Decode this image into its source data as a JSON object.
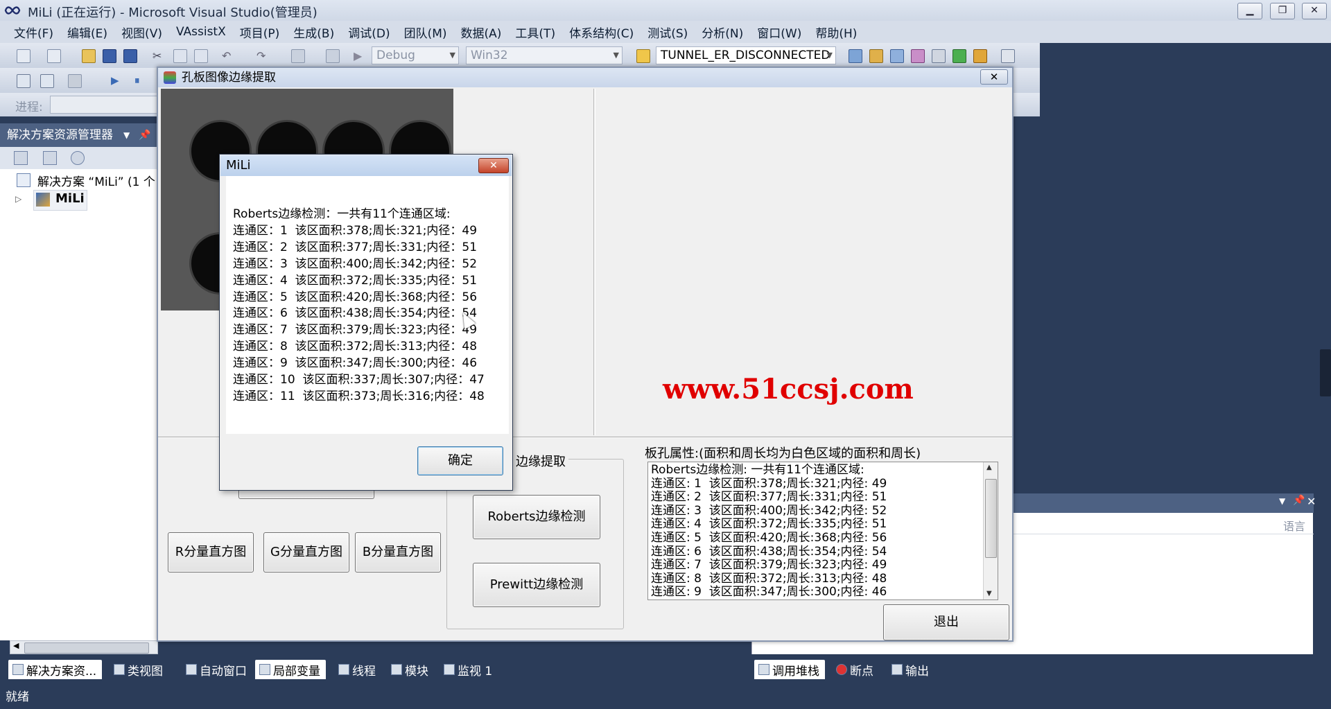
{
  "vs": {
    "title": "MiLi (正在运行) - Microsoft Visual Studio(管理员)",
    "menu": [
      "文件(F)",
      "编辑(E)",
      "视图(V)",
      "VAssistX",
      "项目(P)",
      "生成(B)",
      "调试(D)",
      "团队(M)",
      "数据(A)",
      "工具(T)",
      "体系结构(C)",
      "测试(S)",
      "分析(N)",
      "窗口(W)",
      "帮助(H)"
    ],
    "config_combo": "Debug",
    "platform_combo": "Win32",
    "target_combo": "TUNNEL_ER_DISCONNECTED",
    "progress_label": "进程:",
    "solution_explorer": {
      "header": "解决方案资源管理器",
      "solution_item": "解决方案 “MiLi” (1 个",
      "project_item": "MiLi"
    },
    "right_panel_hint": "语言",
    "bottom_tabs": [
      "解决方案资...",
      "类视图",
      "自动窗口",
      "局部变量",
      "线程",
      "模块",
      "监视 1",
      "调用堆栈",
      "断点",
      "输出"
    ],
    "status": "就绪"
  },
  "app": {
    "title": "孔板图像边缘提取",
    "close_symbol": "✕",
    "watermark": "www.51ccsj.com",
    "buttons": {
      "r_hist": "R分量直方图",
      "g_hist": "G分量直方图",
      "b_hist": "B分量直方图",
      "roberts": "Roberts边缘检测",
      "prewitt": "Prewitt边缘检测",
      "exit": "退出"
    },
    "group_edge_label": "边缘提取",
    "prop_label": "板孔属性:(面积和周长均为白色区域的面积和周长)",
    "prop_text": "Roberts边缘检测: 一共有11个连通区域:\n连通区: 1  该区面积:378;周长:321;内径: 49\n连通区: 2  该区面积:377;周长:331;内径: 51\n连通区: 3  该区面积:400;周长:342;内径: 52\n连通区: 4  该区面积:372;周长:335;内径: 51\n连通区: 5  该区面积:420;周长:368;内径: 56\n连通区: 6  该区面积:438;周长:354;内径: 54\n连通区: 7  该区面积:379;周长:323;内径: 49\n连通区: 8  该区面积:372;周长:313;内径: 48\n连通区: 9  该区面积:347;周长:300;内径: 46"
  },
  "msgbox": {
    "title": "MiLi",
    "close_symbol": "✕",
    "text": "Roberts边缘检测：一共有11个连通区域:\n连通区：1  该区面积:378;周长:321;内径：49\n连通区：2  该区面积:377;周长:331;内径：51\n连通区：3  该区面积:400;周长:342;内径：52\n连通区：4  该区面积:372;周长:335;内径：51\n连通区：5  该区面积:420;周长:368;内径：56\n连通区：6  该区面积:438;周长:354;内径：54\n连通区：7  该区面积:379;周长:323;内径：49\n连通区：8  该区面积:372;周长:313;内径：48\n连通区：9  该区面积:347;周长:300;内径：46\n连通区：10  该区面积:337;周长:307;内径：47\n连通区：11  该区面积:373;周长:316;内径：48",
    "ok": "确定"
  }
}
